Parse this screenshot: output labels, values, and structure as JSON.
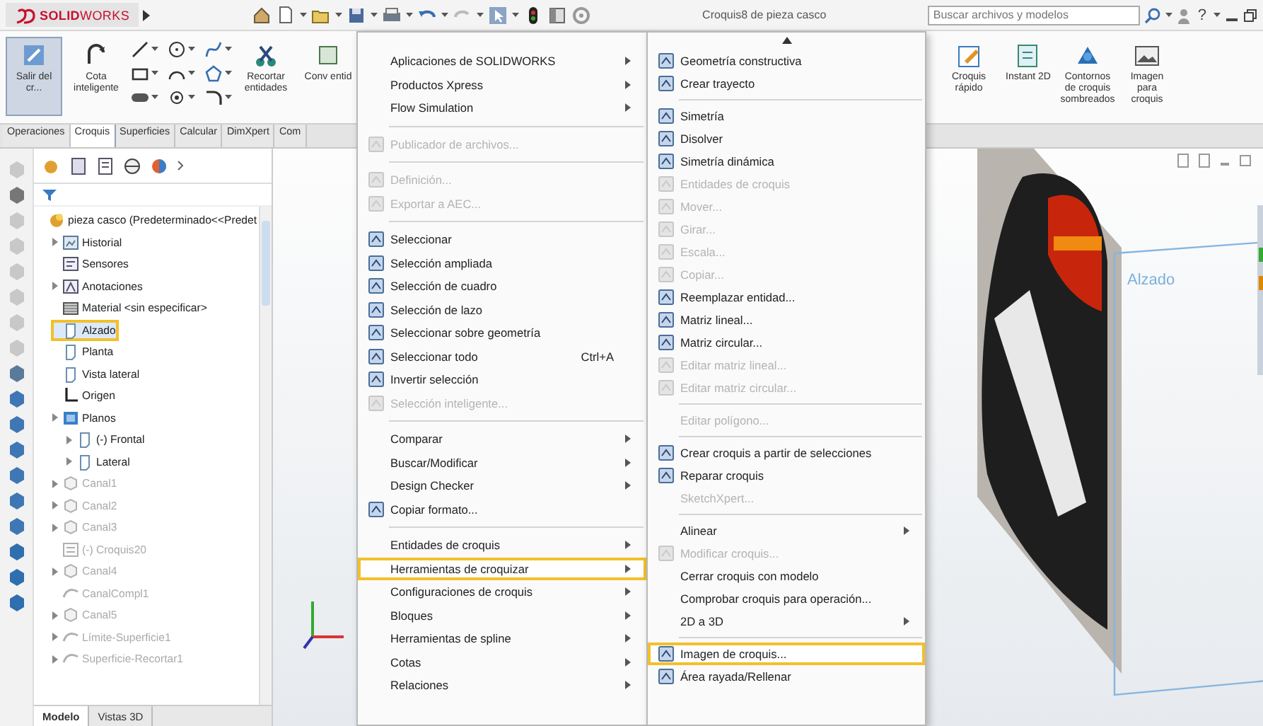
{
  "window": {
    "logo": "**SOLID**WORKS",
    "title": "Croquis8 de pieza casco",
    "search_placeholder": "Buscar archivos y modelos",
    "help": "?"
  },
  "ribbon": {
    "left_buttons": [
      {
        "label": "Salir del cr...",
        "pressed": true
      },
      {
        "label": "Cota inteligente",
        "pressed": false
      }
    ],
    "middle_buttons": [
      {
        "label": "Recortar entidades",
        "pressed": false
      },
      {
        "label": "Conv entid",
        "pressed": false
      }
    ],
    "right_buttons": [
      {
        "label": "Croquis rápido",
        "kind": "quick"
      },
      {
        "label": "Instant 2D",
        "kind": "instant"
      },
      {
        "label": "Contornos de croquis sombreados",
        "kind": "contour"
      },
      {
        "label": "Imagen para croquis",
        "kind": "image"
      }
    ],
    "tabs": [
      {
        "label": "Operaciones",
        "selected": false
      },
      {
        "label": "Croquis",
        "selected": true
      },
      {
        "label": "Superficies",
        "selected": false
      },
      {
        "label": "Calcular",
        "selected": false
      },
      {
        "label": "DimXpert",
        "selected": false
      },
      {
        "label": "Com",
        "selected": false
      }
    ]
  },
  "feature_tree": {
    "items": [
      {
        "label": "pieza casco (Predeterminado<<Predet",
        "kind": "part",
        "expandable": false,
        "selected": false,
        "disabled": false,
        "children": [
          {
            "label": "Historial",
            "kind": "history",
            "expandable": true,
            "selected": false,
            "disabled": false
          },
          {
            "label": "Sensores",
            "kind": "sensor",
            "expandable": false,
            "selected": false,
            "disabled": false
          },
          {
            "label": "Anotaciones",
            "kind": "annotation",
            "expandable": true,
            "selected": false,
            "disabled": false
          },
          {
            "label": "Material <sin especificar>",
            "kind": "material",
            "expandable": false,
            "selected": false,
            "disabled": false
          },
          {
            "label": "Alzado",
            "kind": "plane",
            "expandable": false,
            "selected": true,
            "disabled": false
          },
          {
            "label": "Planta",
            "kind": "plane",
            "expandable": false,
            "selected": false,
            "disabled": false
          },
          {
            "label": "Vista lateral",
            "kind": "plane",
            "expandable": false,
            "selected": false,
            "disabled": false
          },
          {
            "label": "Origen",
            "kind": "origin",
            "expandable": false,
            "selected": false,
            "disabled": false
          },
          {
            "label": "Planos",
            "kind": "folder",
            "expandable": true,
            "selected": false,
            "disabled": false,
            "children": [
              {
                "label": "(-) Frontal",
                "kind": "plane",
                "expandable": true,
                "selected": false,
                "disabled": false
              },
              {
                "label": "Lateral",
                "kind": "plane",
                "expandable": true,
                "selected": false,
                "disabled": false
              }
            ]
          },
          {
            "label": "Canal1",
            "kind": "feature",
            "expandable": true,
            "selected": false,
            "disabled": true
          },
          {
            "label": "Canal2",
            "kind": "feature",
            "expandable": true,
            "selected": false,
            "disabled": true
          },
          {
            "label": "Canal3",
            "kind": "feature",
            "expandable": true,
            "selected": false,
            "disabled": true
          },
          {
            "label": "(-) Croquis20",
            "kind": "sketch",
            "expandable": false,
            "selected": false,
            "disabled": true
          },
          {
            "label": "Canal4",
            "kind": "feature",
            "expandable": true,
            "selected": false,
            "disabled": true
          },
          {
            "label": "CanalCompl1",
            "kind": "surface",
            "expandable": false,
            "selected": false,
            "disabled": true
          },
          {
            "label": "Canal5",
            "kind": "feature",
            "expandable": true,
            "selected": false,
            "disabled": true
          },
          {
            "label": "Límite-Superficie1",
            "kind": "surface",
            "expandable": true,
            "selected": false,
            "disabled": true
          },
          {
            "label": "Superficie-Recortar1",
            "kind": "surface",
            "expandable": true,
            "selected": false,
            "disabled": true
          }
        ]
      }
    ],
    "tabs": [
      {
        "label": "Modelo",
        "selected": true
      },
      {
        "label": "Vistas 3D",
        "selected": false
      }
    ]
  },
  "viewport": {
    "plane_label": "Alzado"
  },
  "context_menu": {
    "items": [
      {
        "kind": "item",
        "label": "Aplicaciones de SOLIDWORKS",
        "icon": false,
        "submenu": true,
        "disabled": false,
        "highlighted": false
      },
      {
        "kind": "item",
        "label": "Productos Xpress",
        "icon": false,
        "submenu": true,
        "disabled": false,
        "highlighted": false
      },
      {
        "kind": "item",
        "label": "Flow Simulation",
        "icon": false,
        "submenu": true,
        "disabled": false,
        "highlighted": false
      },
      {
        "kind": "separator"
      },
      {
        "kind": "item",
        "label": "Publicador de archivos...",
        "icon": true,
        "submenu": false,
        "disabled": true,
        "highlighted": false
      },
      {
        "kind": "separator"
      },
      {
        "kind": "item",
        "label": "Definición...",
        "icon": true,
        "submenu": false,
        "disabled": true,
        "highlighted": false
      },
      {
        "kind": "item",
        "label": "Exportar a AEC...",
        "icon": true,
        "submenu": false,
        "disabled": true,
        "highlighted": false
      },
      {
        "kind": "separator"
      },
      {
        "kind": "item",
        "label": "Seleccionar",
        "icon": true,
        "submenu": false,
        "disabled": false,
        "highlighted": false
      },
      {
        "kind": "item",
        "label": "Selección ampliada",
        "icon": true,
        "submenu": false,
        "disabled": false,
        "highlighted": false
      },
      {
        "kind": "item",
        "label": "Selección de cuadro",
        "icon": true,
        "submenu": false,
        "disabled": false,
        "highlighted": false
      },
      {
        "kind": "item",
        "label": "Selección de lazo",
        "icon": true,
        "submenu": false,
        "disabled": false,
        "highlighted": false
      },
      {
        "kind": "item",
        "label": "Seleccionar sobre geometría",
        "icon": true,
        "submenu": false,
        "disabled": false,
        "highlighted": false
      },
      {
        "kind": "item",
        "label": "Seleccionar todo",
        "shortcut": "Ctrl+A",
        "icon": true,
        "submenu": false,
        "disabled": false,
        "highlighted": false
      },
      {
        "kind": "item",
        "label": "Invertir selección",
        "icon": true,
        "submenu": false,
        "disabled": false,
        "highlighted": false
      },
      {
        "kind": "item",
        "label": "Selección inteligente...",
        "icon": true,
        "submenu": false,
        "disabled": true,
        "highlighted": false
      },
      {
        "kind": "separator"
      },
      {
        "kind": "item",
        "label": "Comparar",
        "icon": false,
        "submenu": true,
        "disabled": false,
        "highlighted": false
      },
      {
        "kind": "item",
        "label": "Buscar/Modificar",
        "icon": false,
        "submenu": true,
        "disabled": false,
        "highlighted": false
      },
      {
        "kind": "item",
        "label": "Design Checker",
        "icon": false,
        "submenu": true,
        "disabled": false,
        "highlighted": false
      },
      {
        "kind": "item",
        "label": "Copiar formato...",
        "icon": true,
        "submenu": false,
        "disabled": false,
        "highlighted": false
      },
      {
        "kind": "separator"
      },
      {
        "kind": "item",
        "label": "Entidades de croquis",
        "icon": false,
        "submenu": true,
        "disabled": false,
        "highlighted": false
      },
      {
        "kind": "item",
        "label": "Herramientas de croquizar",
        "icon": false,
        "submenu": true,
        "disabled": false,
        "highlighted": true
      },
      {
        "kind": "item",
        "label": "Configuraciones de croquis",
        "icon": false,
        "submenu": true,
        "disabled": false,
        "highlighted": false
      },
      {
        "kind": "item",
        "label": "Bloques",
        "icon": false,
        "submenu": true,
        "disabled": false,
        "highlighted": false
      },
      {
        "kind": "item",
        "label": "Herramientas de spline",
        "icon": false,
        "submenu": true,
        "disabled": false,
        "highlighted": false
      },
      {
        "kind": "item",
        "label": "Cotas",
        "icon": false,
        "submenu": true,
        "disabled": false,
        "highlighted": false
      },
      {
        "kind": "item",
        "label": "Relaciones",
        "icon": false,
        "submenu": true,
        "disabled": false,
        "highlighted": false
      }
    ]
  },
  "submenu": {
    "items": [
      {
        "kind": "item",
        "label": "Geometría constructiva",
        "icon": true,
        "submenu": false,
        "disabled": false,
        "highlighted": false
      },
      {
        "kind": "item",
        "label": "Crear trayecto",
        "icon": true,
        "submenu": false,
        "disabled": false,
        "highlighted": false
      },
      {
        "kind": "separator"
      },
      {
        "kind": "item",
        "label": "Simetría",
        "icon": true,
        "submenu": false,
        "disabled": false,
        "highlighted": false
      },
      {
        "kind": "item",
        "label": "Disolver",
        "icon": true,
        "submenu": false,
        "disabled": false,
        "highlighted": false
      },
      {
        "kind": "item",
        "label": "Simetría dinámica",
        "icon": true,
        "submenu": false,
        "disabled": false,
        "highlighted": false
      },
      {
        "kind": "item",
        "label": "Entidades de croquis",
        "icon": true,
        "submenu": false,
        "disabled": true,
        "highlighted": false
      },
      {
        "kind": "item",
        "label": "Mover...",
        "icon": true,
        "submenu": false,
        "disabled": true,
        "highlighted": false
      },
      {
        "kind": "item",
        "label": "Girar...",
        "icon": true,
        "submenu": false,
        "disabled": true,
        "highlighted": false
      },
      {
        "kind": "item",
        "label": "Escala...",
        "icon": true,
        "submenu": false,
        "disabled": true,
        "highlighted": false
      },
      {
        "kind": "item",
        "label": "Copiar...",
        "icon": true,
        "submenu": false,
        "disabled": true,
        "highlighted": false
      },
      {
        "kind": "item",
        "label": "Reemplazar entidad...",
        "icon": true,
        "submenu": false,
        "disabled": false,
        "highlighted": false
      },
      {
        "kind": "item",
        "label": "Matriz lineal...",
        "icon": true,
        "submenu": false,
        "disabled": false,
        "highlighted": false
      },
      {
        "kind": "item",
        "label": "Matriz circular...",
        "icon": true,
        "submenu": false,
        "disabled": false,
        "highlighted": false
      },
      {
        "kind": "item",
        "label": "Editar matriz lineal...",
        "icon": true,
        "submenu": false,
        "disabled": true,
        "highlighted": false
      },
      {
        "kind": "item",
        "label": "Editar matriz circular...",
        "icon": true,
        "submenu": false,
        "disabled": true,
        "highlighted": false
      },
      {
        "kind": "separator"
      },
      {
        "kind": "item",
        "label": "Editar polígono...",
        "icon": false,
        "submenu": false,
        "disabled": true,
        "highlighted": false
      },
      {
        "kind": "separator"
      },
      {
        "kind": "item",
        "label": "Crear croquis a partir de selecciones",
        "icon": true,
        "submenu": false,
        "disabled": false,
        "highlighted": false
      },
      {
        "kind": "item",
        "label": "Reparar croquis",
        "icon": true,
        "submenu": false,
        "disabled": false,
        "highlighted": false
      },
      {
        "kind": "item",
        "label": "SketchXpert...",
        "icon": false,
        "submenu": false,
        "disabled": true,
        "highlighted": false
      },
      {
        "kind": "separator"
      },
      {
        "kind": "item",
        "label": "Alinear",
        "icon": false,
        "submenu": true,
        "disabled": false,
        "highlighted": false
      },
      {
        "kind": "item",
        "label": "Modificar croquis...",
        "icon": true,
        "submenu": false,
        "disabled": true,
        "highlighted": false
      },
      {
        "kind": "item",
        "label": "Cerrar croquis con modelo",
        "icon": false,
        "submenu": false,
        "disabled": false,
        "highlighted": false
      },
      {
        "kind": "item",
        "label": "Comprobar croquis para operación...",
        "icon": false,
        "submenu": false,
        "disabled": false,
        "highlighted": false
      },
      {
        "kind": "item",
        "label": "2D a 3D",
        "icon": false,
        "submenu": true,
        "disabled": false,
        "highlighted": false
      },
      {
        "kind": "separator"
      },
      {
        "kind": "item",
        "label": "Imagen de croquis...",
        "icon": true,
        "submenu": false,
        "disabled": false,
        "highlighted": true
      },
      {
        "kind": "item",
        "label": "Área rayada/Rellenar",
        "icon": true,
        "submenu": false,
        "disabled": false,
        "highlighted": false
      }
    ]
  }
}
